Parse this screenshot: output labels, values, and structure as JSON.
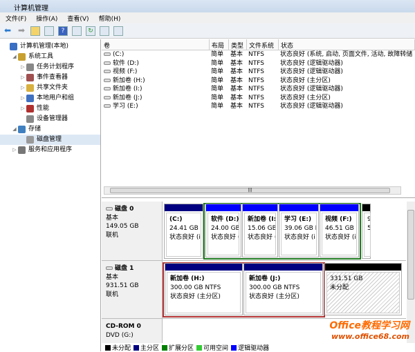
{
  "title": "计算机管理",
  "menu": [
    "文件(F)",
    "操作(A)",
    "查看(V)",
    "帮助(H)"
  ],
  "tree": [
    {
      "label": "计算机管理(本地)",
      "level": 0,
      "arrow": "",
      "color": "#3a6fc4"
    },
    {
      "label": "系统工具",
      "level": 1,
      "arrow": "◢",
      "color": "#c8a030"
    },
    {
      "label": "任务计划程序",
      "level": 2,
      "arrow": "▷",
      "color": "#888"
    },
    {
      "label": "事件查看器",
      "level": 2,
      "arrow": "▷",
      "color": "#a05050"
    },
    {
      "label": "共享文件夹",
      "level": 2,
      "arrow": "▷",
      "color": "#d8b040"
    },
    {
      "label": "本地用户和组",
      "level": 2,
      "arrow": "▷",
      "color": "#4070c0"
    },
    {
      "label": "性能",
      "level": 2,
      "arrow": "▷",
      "color": "#b03030"
    },
    {
      "label": "设备管理器",
      "level": 2,
      "arrow": "",
      "color": "#888"
    },
    {
      "label": "存储",
      "level": 1,
      "arrow": "◢",
      "color": "#4080c0"
    },
    {
      "label": "磁盘管理",
      "level": 2,
      "arrow": "",
      "color": "#999",
      "selected": true
    },
    {
      "label": "服务和应用程序",
      "level": 1,
      "arrow": "▷",
      "color": "#777"
    }
  ],
  "columns": [
    "卷",
    "布局",
    "类型",
    "文件系统",
    "状态"
  ],
  "volumes": [
    [
      "(C:)",
      "简单",
      "基本",
      "NTFS",
      "状态良好 (系统, 启动, 页面文件, 活动, 故障转储"
    ],
    [
      "软件 (D:)",
      "简单",
      "基本",
      "NTFS",
      "状态良好 (逻辑驱动器)"
    ],
    [
      "视频 (F:)",
      "简单",
      "基本",
      "NTFS",
      "状态良好 (逻辑驱动器)"
    ],
    [
      "新加卷 (H:)",
      "简单",
      "基本",
      "NTFS",
      "状态良好 (主分区)"
    ],
    [
      "新加卷 (I:)",
      "简单",
      "基本",
      "NTFS",
      "状态良好 (逻辑驱动器)"
    ],
    [
      "新加卷 (J:)",
      "简单",
      "基本",
      "NTFS",
      "状态良好 (主分区)"
    ],
    [
      "学习 (E:)",
      "简单",
      "基本",
      "NTFS",
      "状态良好 (逻辑驱动器)"
    ]
  ],
  "disk0": {
    "name": "磁盘 0",
    "type": "基本",
    "size": "149.05 GB",
    "status": "联机",
    "parts": [
      [
        "(C:)",
        "24.41 GB I",
        "状态良好 (i"
      ],
      [
        "软件 (D:)",
        "24.00 GB",
        "状态良好 ("
      ],
      [
        "新加卷 (I:",
        "15.06 GB",
        "状态良好 ("
      ],
      [
        "学习 (E:)",
        "39.06 GB N",
        "状态良好 (i"
      ],
      [
        "视频 (F:)",
        "46.51 GB I",
        "状态良好 (i"
      ],
      [
        "",
        "9",
        "5"
      ]
    ]
  },
  "disk1": {
    "name": "磁盘 1",
    "type": "基本",
    "size": "931.51 GB",
    "status": "联机",
    "parts": [
      [
        "新加卷 (H:)",
        "300.00 GB NTFS",
        "状态良好 (主分区)"
      ],
      [
        "新加卷 (J:)",
        "300.00 GB NTFS",
        "状态良好 (主分区)"
      ],
      [
        "",
        "331.51 GB",
        "未分配"
      ]
    ]
  },
  "cdrom": {
    "name": "CD-ROM 0",
    "type": "DVD (G:)"
  },
  "legend": [
    [
      "未分配",
      "#000000"
    ],
    [
      "主分区",
      "#000080"
    ],
    [
      "扩展分区",
      "#008000"
    ],
    [
      "可用空间",
      "#33cc33"
    ],
    [
      "逻辑驱动器",
      "#0000ff"
    ]
  ],
  "watermark": {
    "line1": "Office教程学习网",
    "line2": "www.office68.com"
  }
}
